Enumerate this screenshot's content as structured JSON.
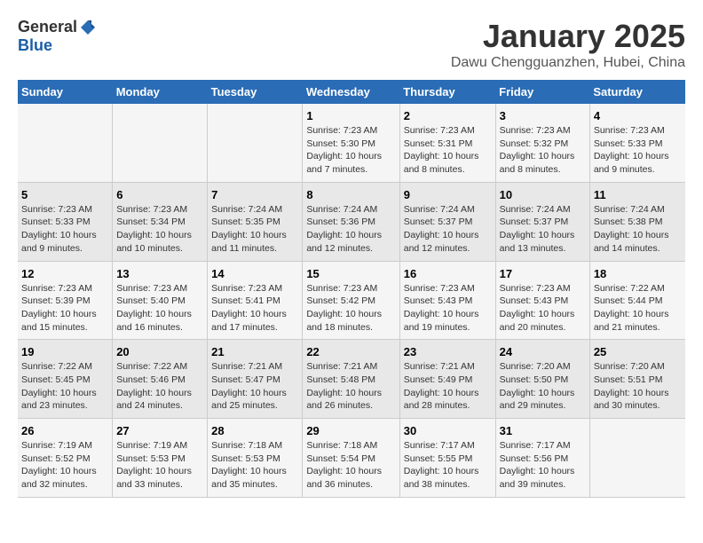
{
  "header": {
    "logo_general": "General",
    "logo_blue": "Blue",
    "title": "January 2025",
    "subtitle": "Dawu Chengguanzhen, Hubei, China"
  },
  "days_of_week": [
    "Sunday",
    "Monday",
    "Tuesday",
    "Wednesday",
    "Thursday",
    "Friday",
    "Saturday"
  ],
  "weeks": [
    [
      {
        "day": "",
        "info": ""
      },
      {
        "day": "",
        "info": ""
      },
      {
        "day": "",
        "info": ""
      },
      {
        "day": "1",
        "info": "Sunrise: 7:23 AM\nSunset: 5:30 PM\nDaylight: 10 hours and 7 minutes."
      },
      {
        "day": "2",
        "info": "Sunrise: 7:23 AM\nSunset: 5:31 PM\nDaylight: 10 hours and 8 minutes."
      },
      {
        "day": "3",
        "info": "Sunrise: 7:23 AM\nSunset: 5:32 PM\nDaylight: 10 hours and 8 minutes."
      },
      {
        "day": "4",
        "info": "Sunrise: 7:23 AM\nSunset: 5:33 PM\nDaylight: 10 hours and 9 minutes."
      }
    ],
    [
      {
        "day": "5",
        "info": "Sunrise: 7:23 AM\nSunset: 5:33 PM\nDaylight: 10 hours and 9 minutes."
      },
      {
        "day": "6",
        "info": "Sunrise: 7:23 AM\nSunset: 5:34 PM\nDaylight: 10 hours and 10 minutes."
      },
      {
        "day": "7",
        "info": "Sunrise: 7:24 AM\nSunset: 5:35 PM\nDaylight: 10 hours and 11 minutes."
      },
      {
        "day": "8",
        "info": "Sunrise: 7:24 AM\nSunset: 5:36 PM\nDaylight: 10 hours and 12 minutes."
      },
      {
        "day": "9",
        "info": "Sunrise: 7:24 AM\nSunset: 5:37 PM\nDaylight: 10 hours and 12 minutes."
      },
      {
        "day": "10",
        "info": "Sunrise: 7:24 AM\nSunset: 5:37 PM\nDaylight: 10 hours and 13 minutes."
      },
      {
        "day": "11",
        "info": "Sunrise: 7:24 AM\nSunset: 5:38 PM\nDaylight: 10 hours and 14 minutes."
      }
    ],
    [
      {
        "day": "12",
        "info": "Sunrise: 7:23 AM\nSunset: 5:39 PM\nDaylight: 10 hours and 15 minutes."
      },
      {
        "day": "13",
        "info": "Sunrise: 7:23 AM\nSunset: 5:40 PM\nDaylight: 10 hours and 16 minutes."
      },
      {
        "day": "14",
        "info": "Sunrise: 7:23 AM\nSunset: 5:41 PM\nDaylight: 10 hours and 17 minutes."
      },
      {
        "day": "15",
        "info": "Sunrise: 7:23 AM\nSunset: 5:42 PM\nDaylight: 10 hours and 18 minutes."
      },
      {
        "day": "16",
        "info": "Sunrise: 7:23 AM\nSunset: 5:43 PM\nDaylight: 10 hours and 19 minutes."
      },
      {
        "day": "17",
        "info": "Sunrise: 7:23 AM\nSunset: 5:43 PM\nDaylight: 10 hours and 20 minutes."
      },
      {
        "day": "18",
        "info": "Sunrise: 7:22 AM\nSunset: 5:44 PM\nDaylight: 10 hours and 21 minutes."
      }
    ],
    [
      {
        "day": "19",
        "info": "Sunrise: 7:22 AM\nSunset: 5:45 PM\nDaylight: 10 hours and 23 minutes."
      },
      {
        "day": "20",
        "info": "Sunrise: 7:22 AM\nSunset: 5:46 PM\nDaylight: 10 hours and 24 minutes."
      },
      {
        "day": "21",
        "info": "Sunrise: 7:21 AM\nSunset: 5:47 PM\nDaylight: 10 hours and 25 minutes."
      },
      {
        "day": "22",
        "info": "Sunrise: 7:21 AM\nSunset: 5:48 PM\nDaylight: 10 hours and 26 minutes."
      },
      {
        "day": "23",
        "info": "Sunrise: 7:21 AM\nSunset: 5:49 PM\nDaylight: 10 hours and 28 minutes."
      },
      {
        "day": "24",
        "info": "Sunrise: 7:20 AM\nSunset: 5:50 PM\nDaylight: 10 hours and 29 minutes."
      },
      {
        "day": "25",
        "info": "Sunrise: 7:20 AM\nSunset: 5:51 PM\nDaylight: 10 hours and 30 minutes."
      }
    ],
    [
      {
        "day": "26",
        "info": "Sunrise: 7:19 AM\nSunset: 5:52 PM\nDaylight: 10 hours and 32 minutes."
      },
      {
        "day": "27",
        "info": "Sunrise: 7:19 AM\nSunset: 5:53 PM\nDaylight: 10 hours and 33 minutes."
      },
      {
        "day": "28",
        "info": "Sunrise: 7:18 AM\nSunset: 5:53 PM\nDaylight: 10 hours and 35 minutes."
      },
      {
        "day": "29",
        "info": "Sunrise: 7:18 AM\nSunset: 5:54 PM\nDaylight: 10 hours and 36 minutes."
      },
      {
        "day": "30",
        "info": "Sunrise: 7:17 AM\nSunset: 5:55 PM\nDaylight: 10 hours and 38 minutes."
      },
      {
        "day": "31",
        "info": "Sunrise: 7:17 AM\nSunset: 5:56 PM\nDaylight: 10 hours and 39 minutes."
      },
      {
        "day": "",
        "info": ""
      }
    ]
  ]
}
